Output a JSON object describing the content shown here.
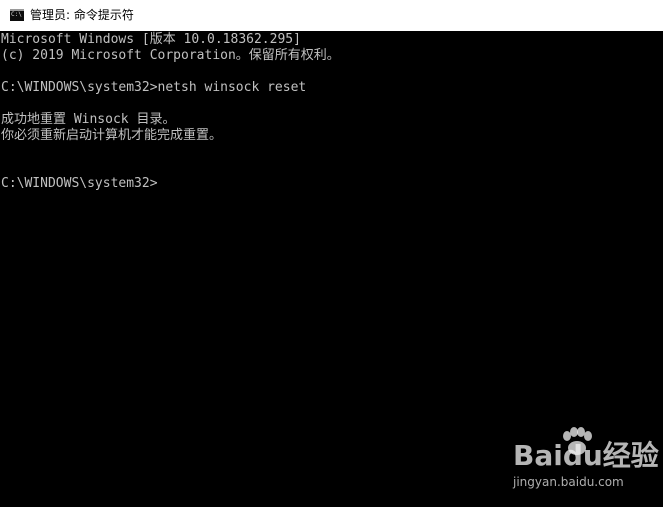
{
  "window": {
    "title": "管理员: 命令提示符",
    "icon": "cmd-icon"
  },
  "console": {
    "lines": [
      "Microsoft Windows [版本 10.0.18362.295]",
      "(c) 2019 Microsoft Corporation。保留所有权利。",
      "C:\\WINDOWS\\system32>netsh winsock reset",
      "成功地重置 Winsock 目录。",
      "你必须重新启动计算机才能完成重置。",
      "C:\\WINDOWS\\system32>"
    ]
  },
  "watermark": {
    "brand": "Baidu经验",
    "url": "jingyan.baidu.com",
    "icon": "baidu-paw-icon"
  },
  "colors": {
    "console_background": "#000000",
    "console_text": "#c0c0c0",
    "titlebar_background": "#ffffff"
  }
}
